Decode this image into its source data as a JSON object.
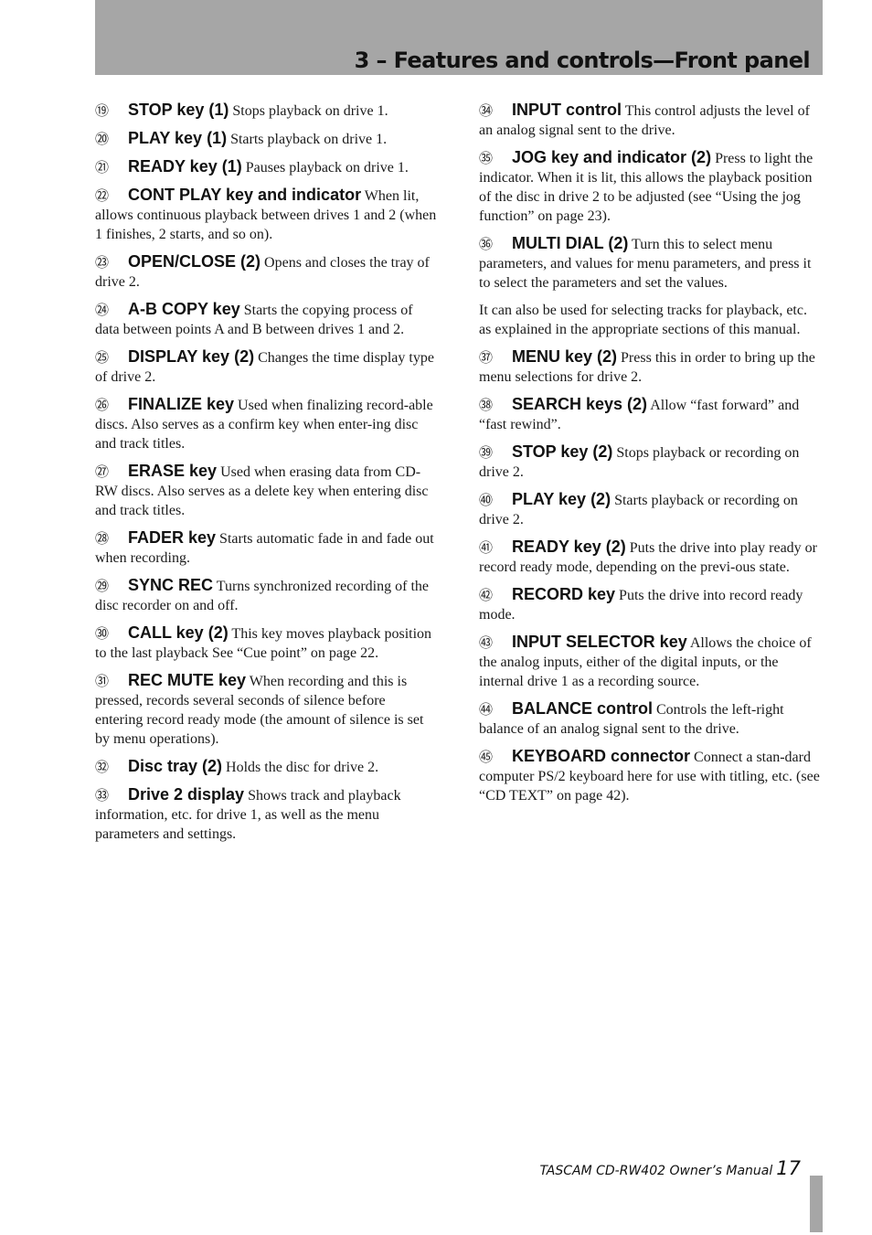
{
  "header": {
    "title": "3 – Features and controls—Front panel"
  },
  "left_column": {
    "items": [
      {
        "number": "⑲",
        "term": "STOP key (1)",
        "text": "Stops playback on drive 1."
      },
      {
        "number": "⑳",
        "term": "PLAY key (1)",
        "text": "Starts playback on drive 1."
      },
      {
        "number": "㉑",
        "term": "READY key (1)",
        "text": "Pauses playback on drive 1."
      },
      {
        "number": "㉒",
        "term": "CONT PLAY key and indicator",
        "text": "When lit, allows continuous playback between drives 1 and 2 (when 1 finishes, 2 starts, and so on)."
      },
      {
        "number": "㉓",
        "term": "OPEN/CLOSE (2)",
        "text": "Opens and closes the tray of drive 2."
      },
      {
        "number": "㉔",
        "term": "A-B COPY key",
        "text": "Starts the copying process of data between points A and B between drives 1 and 2."
      },
      {
        "number": "㉕",
        "term": "DISPLAY key (2)",
        "text": "Changes the time display type of drive 2."
      },
      {
        "number": "㉖",
        "term": "FINALIZE key",
        "text": "Used when finalizing record-able discs. Also serves as a confirm key when enter-ing disc and track titles."
      },
      {
        "number": "㉗",
        "term": "ERASE key",
        "text": "Used when erasing data from CD-RW discs. Also serves as a delete key when entering disc and track titles."
      },
      {
        "number": "㉘",
        "term": "FADER key",
        "text": "Starts automatic fade in and fade out when recording."
      },
      {
        "number": "㉙",
        "term": "SYNC REC",
        "text": "Turns synchronized recording of the disc recorder on and off."
      },
      {
        "number": "㉚",
        "term": "CALL key (2)",
        "text": "This key moves playback position to the last playback See “Cue point” on page 22."
      },
      {
        "number": "㉛",
        "term": "REC MUTE key",
        "text": "When recording and this is pressed, records several seconds of silence before entering record ready mode (the amount of silence is set by menu operations)."
      },
      {
        "number": "㉜",
        "term": "Disc tray (2)",
        "text": "Holds the disc for drive 2."
      },
      {
        "number": "㉝",
        "term": "Drive 2 display",
        "text": "Shows track and playback information, etc. for drive 1, as well as the menu parameters and settings."
      }
    ]
  },
  "right_column": {
    "items_a": [
      {
        "number": "㉞",
        "term": "INPUT control",
        "text": "This control adjusts the level of an analog signal sent to the drive."
      },
      {
        "number": "㉟",
        "term": "JOG key and indicator (2)",
        "text": "Press to light the indicator. When it is lit, this allows the playback position of the disc in drive 2 to be adjusted (see “Using the jog function” on page 23)."
      },
      {
        "number": "㊱",
        "term": "MULTI DIAL (2)",
        "text": "Turn this to select menu parameters, and values for menu parameters, and press it to select the parameters and set the values."
      }
    ],
    "paragraph": "It can also be used for selecting tracks for playback, etc. as explained in the appropriate sections of this manual.",
    "items_b": [
      {
        "number": "㊲",
        "term": "MENU key (2)",
        "text": "Press this in order to bring up the menu selections for drive 2."
      },
      {
        "number": "㊳",
        "term": "SEARCH keys (2)",
        "text": "Allow “fast forward” and “fast rewind”."
      },
      {
        "number": "㊴",
        "term": "STOP key (2)",
        "text": "Stops playback or recording on drive 2."
      },
      {
        "number": "㊵",
        "term": "PLAY key (2)",
        "text": "Starts playback or recording on drive 2."
      },
      {
        "number": "㊶",
        "term": "READY key (2)",
        "text": "Puts the drive into play ready or record ready mode, depending on the previ-ous state."
      },
      {
        "number": "㊷",
        "term": "RECORD key",
        "text": "Puts the drive into record ready mode."
      },
      {
        "number": "㊸",
        "term": "INPUT SELECTOR key",
        "text": "Allows the choice of the analog inputs, either of the digital inputs, or the internal drive 1 as a recording source."
      },
      {
        "number": "㊹",
        "term": "BALANCE control",
        "text": "Controls the left-right balance of an analog signal sent to the drive."
      },
      {
        "number": "㊺",
        "term": "KEYBOARD connector",
        "text": "Connect a stan-dard computer PS/2 keyboard here for use with titling, etc. (see “CD TEXT” on page 42)."
      }
    ]
  },
  "footer": {
    "manual_title": "TASCAM CD-RW402 Owner’s Manual",
    "page_number": "17"
  },
  "colors": {
    "header_band": "#a6a6a6",
    "text": "#111111"
  }
}
